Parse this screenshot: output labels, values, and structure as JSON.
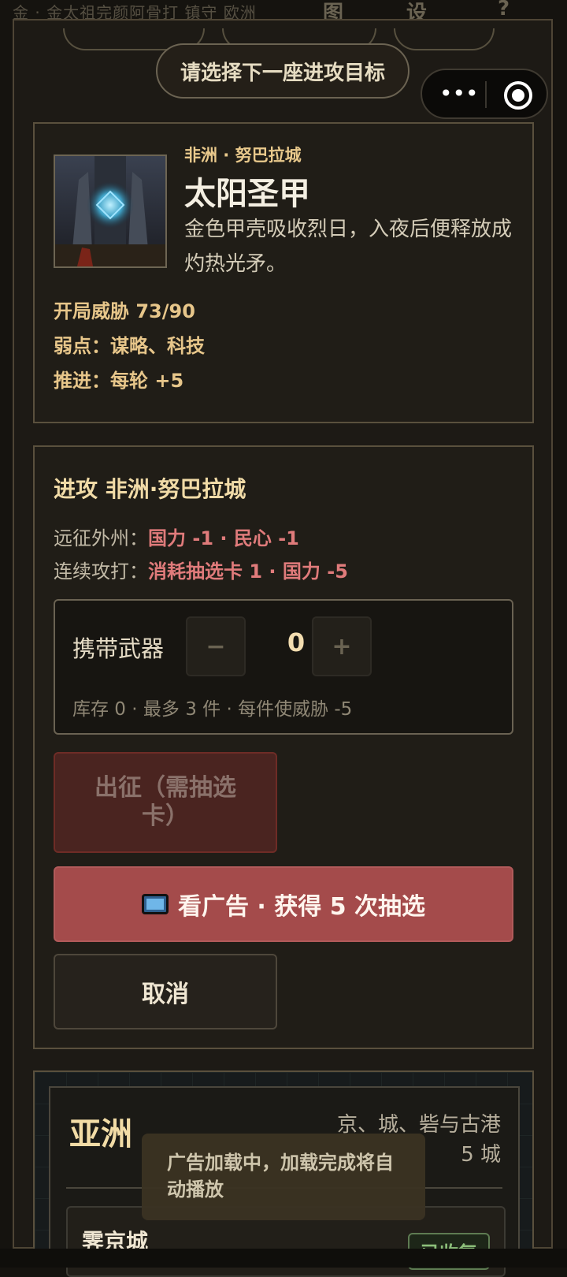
{
  "top_bar": {
    "crumb": "金 · 金太祖完颜阿骨打 镇守 欧洲",
    "nav_items": [
      "图",
      "设",
      "?"
    ]
  },
  "header": {
    "prompt": "请选择下一座进攻目标"
  },
  "capsule": {
    "more_icon": "more-dots-icon",
    "close_icon": "target-circle-icon"
  },
  "enemy": {
    "region": "非洲 · 努巴拉城",
    "name": "太阳圣甲",
    "description": "金色甲壳吸收烈日，入夜后便释放成灼热光矛。",
    "stats": [
      "开局威胁 73/90",
      "弱点：谋略、科技",
      "推进：每轮 +5"
    ]
  },
  "attack": {
    "title": "进攻 非洲·努巴拉城",
    "expedition_label": "远征外州：",
    "expedition_cost": "国力 -1 · 民心 -1",
    "continuous_label": "连续攻打：",
    "continuous_cost": "消耗抽选卡 1 · 国力 -5",
    "weapons": {
      "label": "携带武器",
      "minus": "−",
      "quantity": "0",
      "plus": "+",
      "note": "库存 0 · 最多 3 件 · 每件使威胁 -5"
    },
    "depart_button": "出征（需抽选卡）",
    "ad_button": "看广告 · 获得 5 次抽选",
    "cancel_button": "取消"
  },
  "asia": {
    "continent": "亚洲",
    "cities": "京、城、砦与古港",
    "count": "5 城",
    "first_city": "霁京城",
    "first_city_status": "已收复"
  },
  "toast": {
    "message": "广告加载中，加载完成将自动播放"
  },
  "colors": {
    "accent_gold": "#e7c68a",
    "danger_text": "#e07b7b",
    "ad_button": "#a44b4b",
    "depart_button": "#4a2420"
  }
}
